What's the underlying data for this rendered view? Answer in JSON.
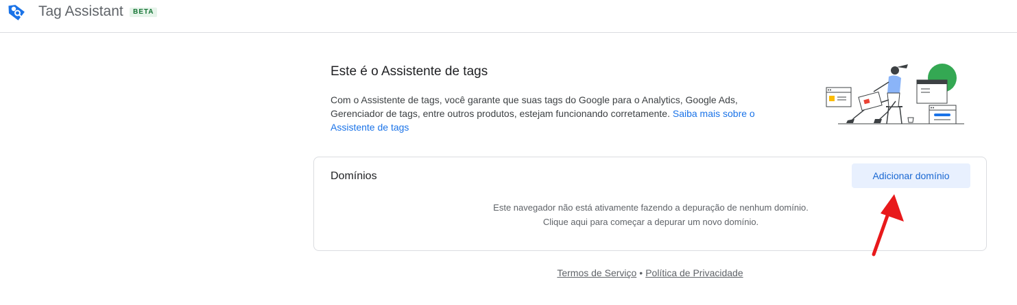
{
  "header": {
    "app_title": "Tag Assistant",
    "badge": "BETA",
    "logo_icon": "tag-assistant-icon",
    "brand_color": "#1a73e8"
  },
  "intro": {
    "title": "Este é o Assistente de tags",
    "text": "Com o Assistente de tags, você garante que suas tags do Google para o Analytics, Google Ads, Gerenciador de tags, entre outros produtos, estejam funcionando corretamente. ",
    "link_label": "Saiba mais sobre o Assistente de tags",
    "illustration": "person-with-browser-windows-illustration"
  },
  "domains": {
    "title": "Domínios",
    "add_button_label": "Adicionar domínio",
    "empty_line1": "Este navegador não está ativamente fazendo a depuração de nenhum domínio.",
    "empty_line2": "Clique aqui para começar a depurar um novo domínio."
  },
  "annotation": {
    "arrow_color": "#e8191b"
  },
  "footer": {
    "terms_label": "Termos de Serviço",
    "separator": "•",
    "privacy_label": "Política de Privacidade"
  }
}
